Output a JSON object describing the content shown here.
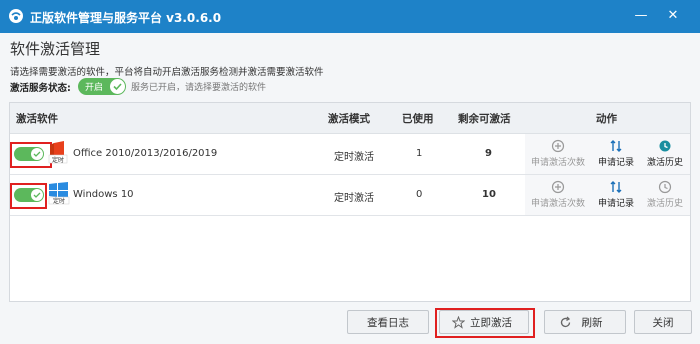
{
  "window": {
    "title": "正版软件管理与服务平台 v3.0.6.0"
  },
  "page": {
    "title": "软件激活管理",
    "description": "请选择需要激活的软件，平台将自动开启激活服务检测并激活需要激活软件",
    "service_label": "激活服务状态:",
    "service_toggle_text": "开启",
    "service_hint": "服务已开启，请选择要激活的软件"
  },
  "table": {
    "headers": {
      "software": "激活软件",
      "mode": "激活模式",
      "used": "已使用",
      "remaining": "剩余可激活",
      "actions": "动作"
    },
    "rows": [
      {
        "name": "Office 2010/2013/2016/2019",
        "badge": "定时",
        "mode": "定时激活",
        "used": "1",
        "remaining": "9",
        "enabled": true,
        "actions": {
          "apply_count": "申请激活次数",
          "apply_record": "申请记录",
          "history": "激活历史"
        }
      },
      {
        "name": "Windows 10",
        "badge": "定时",
        "mode": "定时激活",
        "used": "0",
        "remaining": "10",
        "enabled": true,
        "actions": {
          "apply_count": "申请激活次数",
          "apply_record": "申请记录",
          "history": "激活历史"
        }
      }
    ]
  },
  "buttons": {
    "log": "查看日志",
    "activate": "立即激活",
    "refresh": "刷新",
    "close": "关闭"
  },
  "colors": {
    "titlebar": "#1e82c8",
    "toggle_on": "#5cb85c",
    "highlight": "#e02020",
    "action_blue": "#1a6fb8",
    "disabled": "#999999"
  }
}
